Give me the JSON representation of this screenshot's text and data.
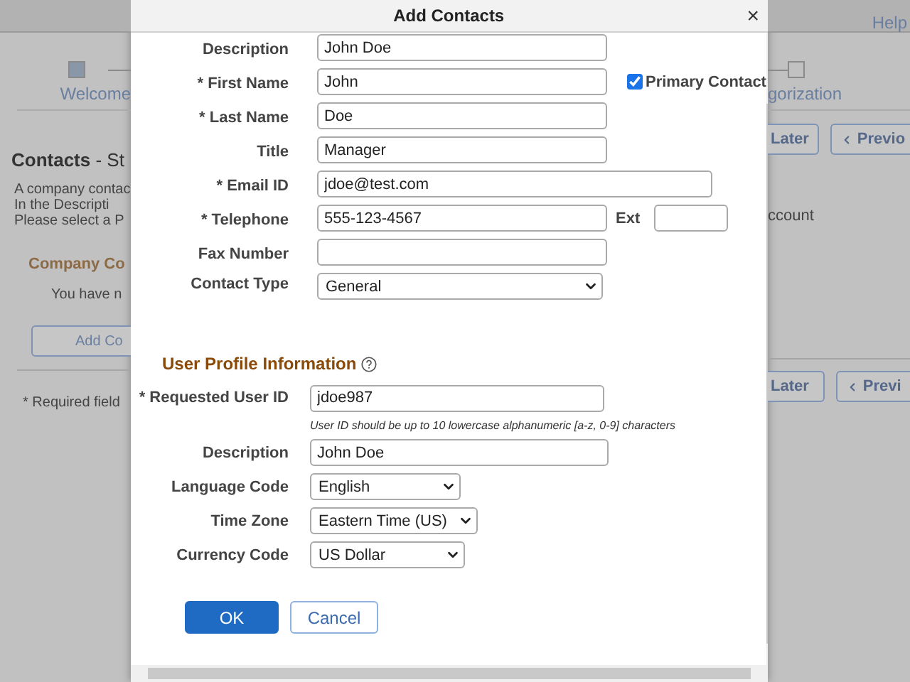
{
  "background": {
    "help": "Help",
    "left_step": "Welcome",
    "right_step": "gorization",
    "heading": "**Contacts** - St",
    "intro": [
      "A company contac",
      "In the Descripti",
      "Please select a P"
    ],
    "intro_tail": "ccount",
    "section": "Company Co",
    "empty_text": "You have n",
    "add_button": "Add Co",
    "required_note": "* Required field",
    "top_buttons": [
      "Later",
      "Previo"
    ],
    "bottom_buttons": [
      "Later",
      "Previ"
    ]
  },
  "dialog": {
    "title": "Add Contacts",
    "close": "×",
    "contact_fields": [
      {
        "label": "Description",
        "kind": "text",
        "value": "John Doe"
      },
      {
        "label": "* First Name",
        "kind": "text",
        "value": "John",
        "checkbox": {
          "label": "Primary Contact",
          "checked": true
        }
      },
      {
        "label": "* Last Name",
        "kind": "text",
        "value": "Doe"
      },
      {
        "label": "Title",
        "kind": "text",
        "value": "Manager"
      },
      {
        "label": "* Email ID",
        "kind": "wide",
        "value": "jdoe@test.com"
      },
      {
        "label": "* Telephone",
        "kind": "text",
        "value": "555-123-4567",
        "ext": {
          "label": "Ext"
        }
      },
      {
        "label": "Fax Number",
        "kind": "text"
      },
      {
        "label": "Contact Type",
        "kind": "select",
        "value": "General"
      }
    ],
    "profile": {
      "title": "User Profile Information",
      "fields": [
        {
          "label": "* Requested User ID",
          "kind": "text",
          "value": "jdoe987",
          "hint": "User ID should be up to 10 lowercase alphanumeric [a-z, 0-9] characters"
        },
        {
          "label": "Description",
          "kind": "text",
          "value": "John Doe"
        },
        {
          "label": "Language Code",
          "kind": "select",
          "value": "English"
        },
        {
          "label": "Time Zone",
          "kind": "select",
          "value": "Eastern Time (US)"
        },
        {
          "label": "Currency Code",
          "kind": "select",
          "value": "US Dollar"
        }
      ]
    },
    "buttons": [
      {
        "label": "OK",
        "kind": "primary"
      },
      {
        "label": "Cancel",
        "kind": "secondary"
      }
    ]
  }
}
